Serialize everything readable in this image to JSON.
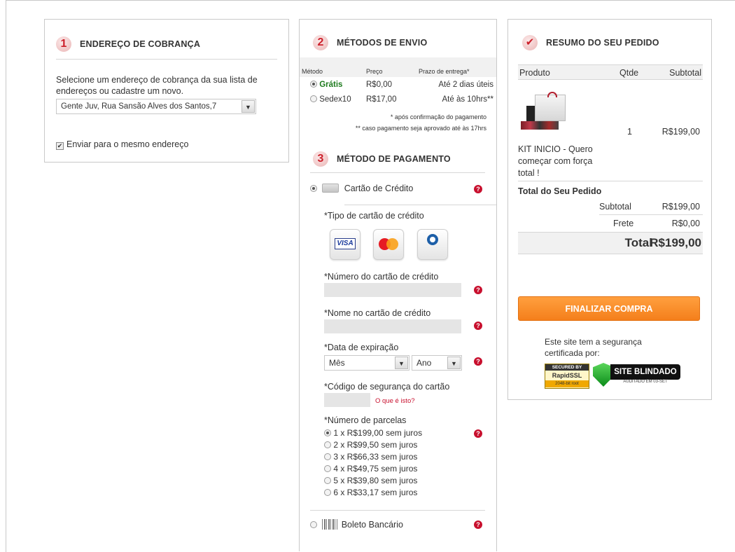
{
  "billing": {
    "step": "1",
    "title": "ENDEREÇO DE COBRANÇA",
    "description": "Selecione um endereço de cobrança da sua lista de endereços ou cadastre um novo.",
    "address_selected": "Gente Juv, Rua Sansão Alves dos Santos,7",
    "same_address_label": "Enviar para o mesmo endereço"
  },
  "shipping": {
    "step": "2",
    "title": "MÉTODOS DE ENVIO",
    "col_method": "Método",
    "col_price": "Preço",
    "col_deadline": "Prazo de entrega*",
    "options": [
      {
        "name": "Grátis",
        "price": "R$0,00",
        "deadline": "Até 2 dias úteis",
        "selected": true
      },
      {
        "name": "Sedex10",
        "price": "R$17,00",
        "deadline": "Até às 10hrs**",
        "selected": false
      }
    ],
    "note1": "* após confirmação do pagamento",
    "note2": "** caso pagamento seja aprovado até às 17hrs"
  },
  "payment": {
    "step": "3",
    "title": "MÉTODO DE PAGAMENTO",
    "credit_card_label": "Cartão de Crédito",
    "card_type_label": "*Tipo de cartão de crédito",
    "card_brands": [
      "VISA",
      "MasterCard",
      "Diners Club"
    ],
    "card_number_label": "*Número do cartão de crédito",
    "card_name_label": "*Nome no cartão de crédito",
    "expiry_label": "*Data de expiração",
    "month_placeholder": "Mês",
    "year_placeholder": "Ano",
    "cvv_label": "*Código de segurança do cartão",
    "cvv_help": "O que é isto?",
    "installments_label": "*Número de parcelas",
    "installments": [
      "1 x R$199,00 sem juros",
      "2 x R$99,50 sem juros",
      "3 x R$66,33 sem juros",
      "4 x R$49,75 sem juros",
      "5 x R$39,80 sem juros",
      "6 x R$33,17 sem juros"
    ],
    "boleto_label": "Boleto Bancário"
  },
  "summary": {
    "title": "RESUMO DO SEU PEDIDO",
    "col_product": "Produto",
    "col_qty": "Qtde",
    "col_subtotal": "Subtotal",
    "item_name": "KIT INICIO - Quero começar com força total !",
    "item_qty": "1",
    "item_subtotal": "R$199,00",
    "total_heading": "Total do Seu Pedido",
    "subtotal_label": "Subtotal",
    "subtotal_value": "R$199,00",
    "freight_label": "Frete",
    "freight_value": "R$0,00",
    "total_label": "Total",
    "total_value": "R$199,00",
    "finalize_button": "FINALIZAR COMPRA",
    "security_text": "Este site tem a segurança certificada por:",
    "badge_rapidssl_line1": "SECURED BY",
    "badge_rapidssl_line2": "RapidSSL",
    "badge_rapidssl_line3": "2048-bit root",
    "badge_blindado_line1": "SITE BLINDADO",
    "badge_blindado_line2": "AUDITADO EM 03-SET"
  }
}
